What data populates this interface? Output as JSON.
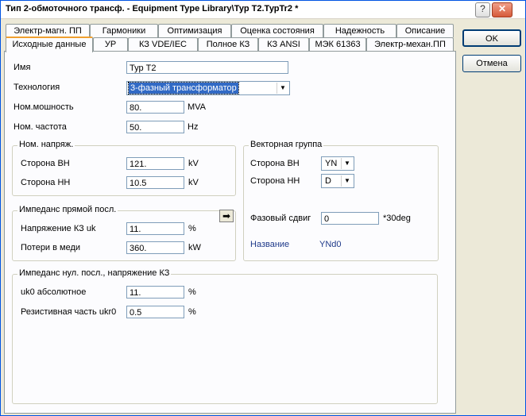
{
  "window": {
    "title": "Тип 2-обмоточного трансф. - Equipment Type Library\\Тур Т2.ТурTr2 *",
    "help_label": "?",
    "close_label": "✕"
  },
  "tabs_row1": [
    "Электр-магн. ПП",
    "Гармоники",
    "Оптимизация",
    "Оценка состояния",
    "Надежность",
    "Описание"
  ],
  "tabs_row2": [
    "Исходные данные",
    "УР",
    "КЗ VDE/IEC",
    "Полное КЗ",
    "КЗ ANSI",
    "МЭК 61363",
    "Электр-механ.ПП"
  ],
  "buttons": {
    "ok": "OK",
    "cancel": "Отмена"
  },
  "general": {
    "name_label": "Имя",
    "name_value": "Тур Т2",
    "tech_label": "Технология",
    "tech_value": "3-фазный трансформатор",
    "power_label": "Ном.мошность",
    "power_value": "80.",
    "power_unit": "MVA",
    "freq_label": "Ном. частота",
    "freq_value": "50.",
    "freq_unit": "Hz"
  },
  "voltage": {
    "title": "Ном. напряж.",
    "hv_label": "Сторона ВН",
    "hv_value": "121.",
    "hv_unit": "kV",
    "lv_label": "Сторона НН",
    "lv_value": "10.5",
    "lv_unit": "kV"
  },
  "vector": {
    "title": "Векторная группа",
    "hv_label": "Сторона ВН",
    "hv_value": "YN",
    "lv_label": "Сторона НН",
    "lv_value": "D",
    "phase_label": "Фазовый сдвиг",
    "phase_value": "0",
    "phase_unit": "*30deg",
    "name_label": "Название",
    "name_value": "YNd0"
  },
  "positive": {
    "title": "Импеданс прямой посл.",
    "uk_label": "Напряжение КЗ uk",
    "uk_value": "11.",
    "uk_unit": "%",
    "loss_label": "Потери в меди",
    "loss_value": "360.",
    "loss_unit": "kW"
  },
  "zero": {
    "title": "Импеданс нул. посл., напряжение КЗ",
    "uk0_label": "uk0 абсолютное",
    "uk0_value": "11.",
    "uk0_unit": "%",
    "ukr0_label": "Резистивная часть ukr0",
    "ukr0_value": "0.5",
    "ukr0_unit": "%"
  },
  "icons": {
    "arrow": "arrow-right-icon"
  }
}
